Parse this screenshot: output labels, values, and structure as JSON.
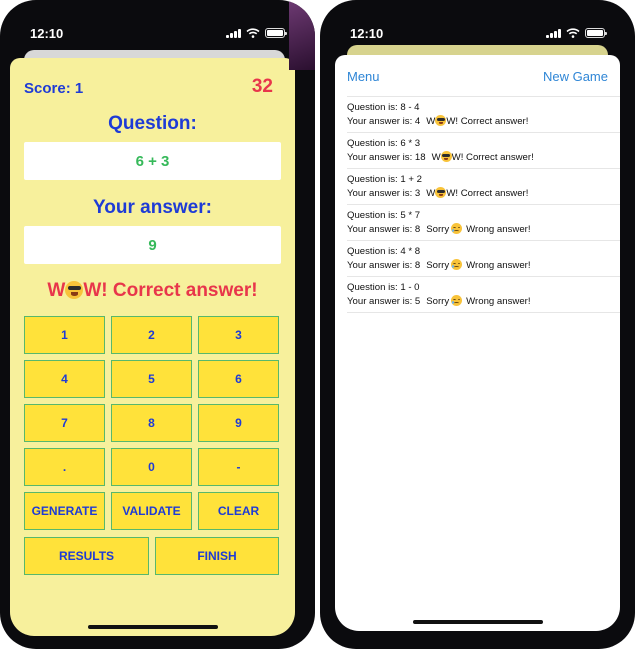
{
  "status_bar": {
    "time": "12:10"
  },
  "game": {
    "score": "Score: 1",
    "counter": "32",
    "question_label": "Question:",
    "question": "6 + 3",
    "answer_label": "Your answer:",
    "answer": "9",
    "feedback_prefix": "W",
    "feedback_emoji": "star-struck-emoji",
    "feedback_suffix": "W! Correct answer!"
  },
  "keypad": {
    "rows": [
      [
        "1",
        "2",
        "3"
      ],
      [
        "4",
        "5",
        "6"
      ],
      [
        "7",
        "8",
        "9"
      ],
      [
        ".",
        "0",
        "-"
      ],
      [
        "GENERATE",
        "VALIDATE",
        "CLEAR"
      ]
    ],
    "bottom": [
      "RESULTS",
      "FINISH"
    ]
  },
  "results_screen": {
    "menu": "Menu",
    "new_game": "New Game",
    "rows": [
      {
        "question": "Question is: 8 - 4",
        "answer": "Your answer is: 4",
        "verdict_prefix": "W",
        "emoji": "star-struck-emoji",
        "verdict": "W! Correct answer!"
      },
      {
        "question": "Question is: 6 * 3",
        "answer": "Your answer is: 18",
        "verdict_prefix": "W",
        "emoji": "star-struck-emoji",
        "verdict": "W! Correct answer!"
      },
      {
        "question": "Question is: 1 + 2",
        "answer": "Your answer is: 3",
        "verdict_prefix": "W",
        "emoji": "star-struck-emoji",
        "verdict": "W! Correct answer!"
      },
      {
        "question": "Question is: 5 * 7",
        "answer": "Your answer is: 8",
        "verdict_prefix": "Sorry",
        "emoji": "sad-tear-emoji",
        "verdict": "Wrong answer!"
      },
      {
        "question": "Question is: 4 * 8",
        "answer": "Your answer is: 8",
        "verdict_prefix": "Sorry",
        "emoji": "sad-tear-emoji",
        "verdict": "Wrong answer!"
      },
      {
        "question": "Question is: 1 - 0",
        "answer": "Your answer is: 5",
        "verdict_prefix": "Sorry",
        "emoji": "sad-tear-emoji",
        "verdict": "Wrong answer!"
      }
    ]
  },
  "colors": {
    "sheet_background": "#f7f09c",
    "accent_blue": "#1e3bd6",
    "accent_red": "#e8364b",
    "accent_green": "#36b95a",
    "button_yellow": "#ffe23a",
    "link_blue": "#2f86d6"
  }
}
